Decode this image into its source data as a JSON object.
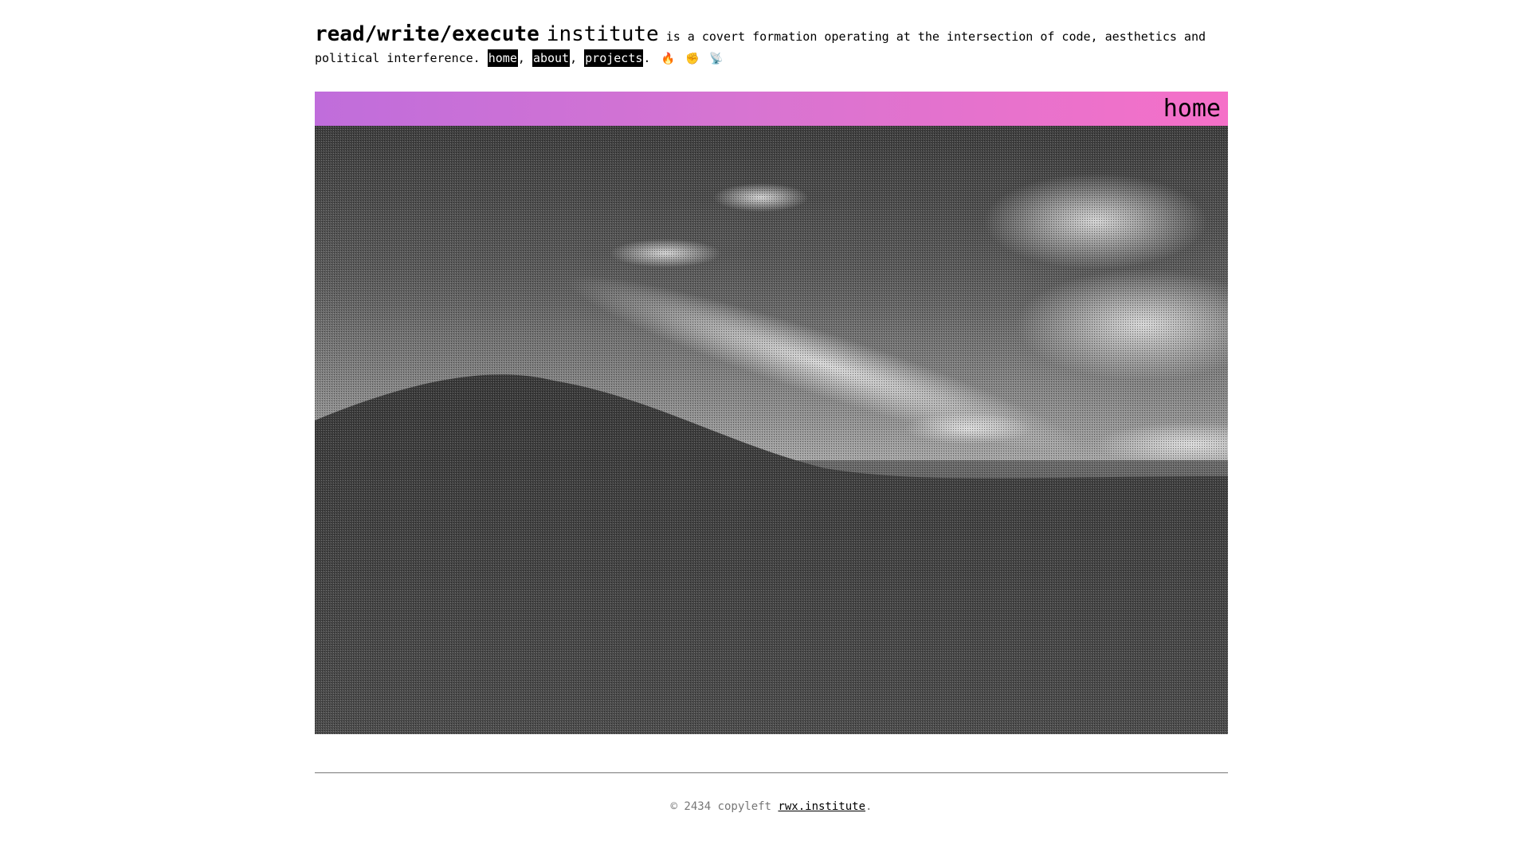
{
  "header": {
    "brand_bold": "read/write/execute",
    "brand_light": "institute",
    "tagline": "is a covert formation operating at the intersection of code, aesthetics and political interference.",
    "nav": [
      {
        "label": "home"
      },
      {
        "label": "about"
      },
      {
        "label": "projects"
      }
    ],
    "sep1": ",",
    "sep2": ",",
    "end": ".",
    "emojis": [
      "🔥",
      "✊",
      "📡"
    ]
  },
  "banner": {
    "title": "home",
    "gradient_start": "#c06ddb",
    "gradient_end": "#f570c8"
  },
  "hero_image": {
    "icon": "dithered-landscape-image"
  },
  "footer": {
    "copyright": "© 2434 copyleft",
    "link": "rwx.institute",
    "end": "."
  }
}
